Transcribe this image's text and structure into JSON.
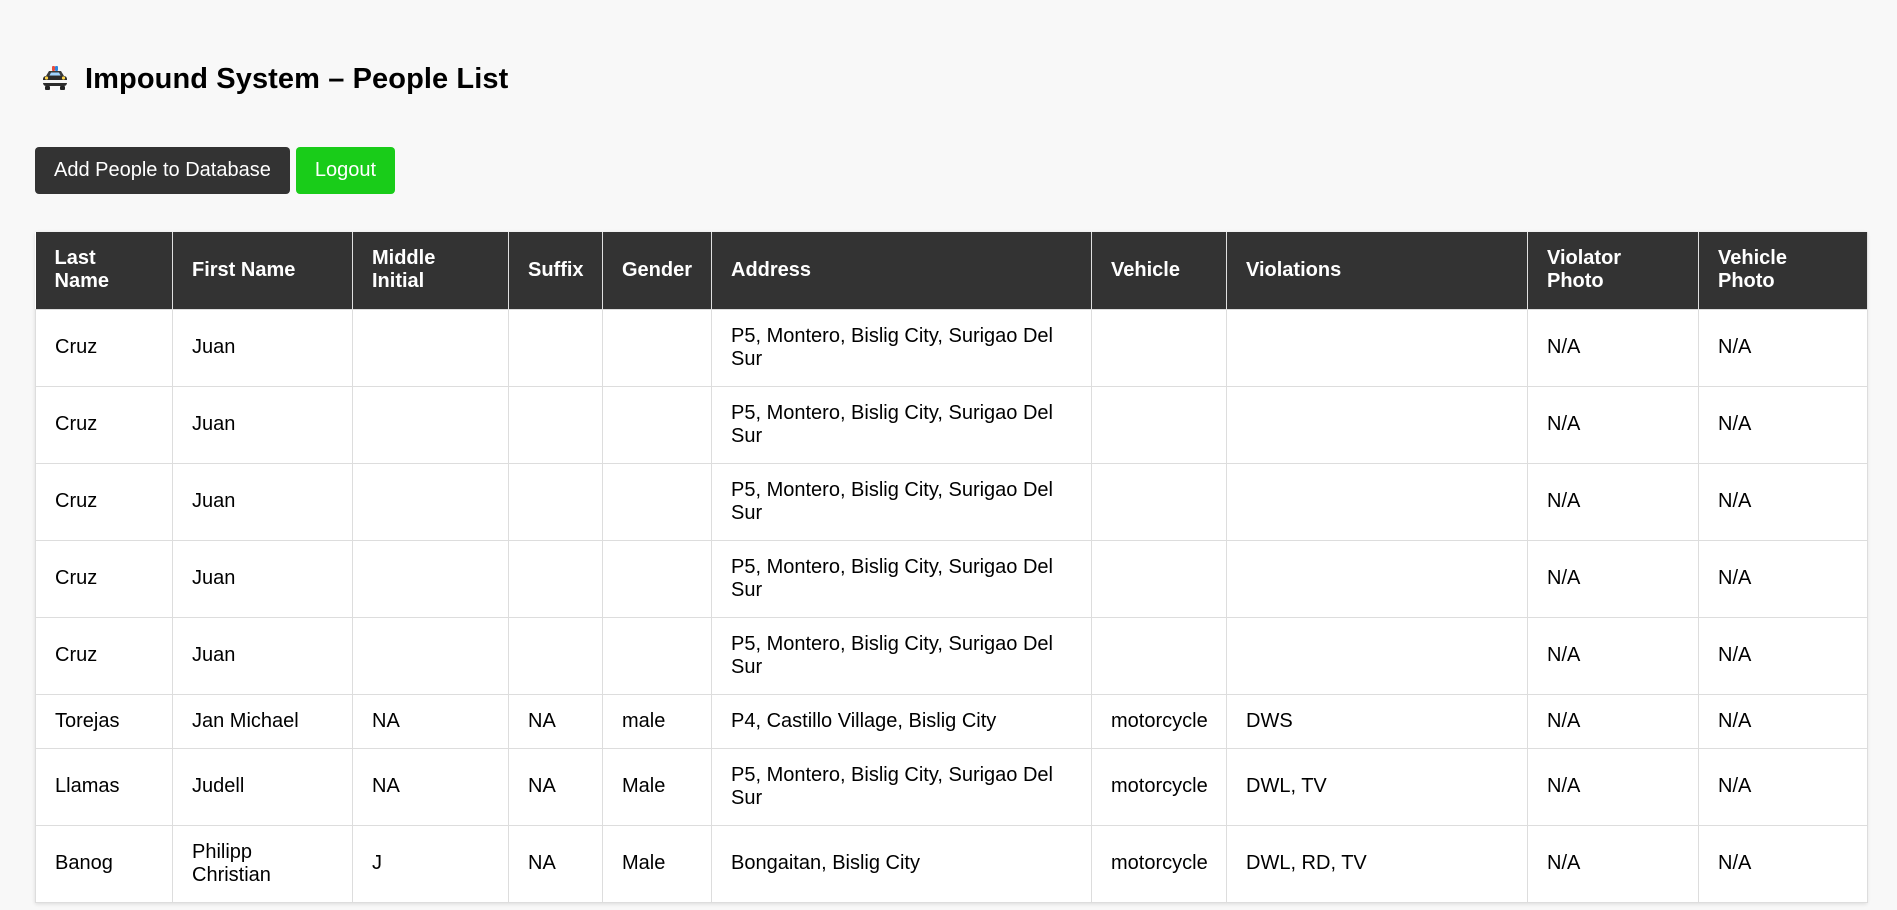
{
  "header": {
    "icon": "police-car-icon",
    "title": "Impound System – People List"
  },
  "actions": {
    "add_label": "Add People to Database",
    "logout_label": "Logout",
    "add_color": "#333333",
    "logout_color": "#19cc19"
  },
  "table": {
    "columns": [
      "Last Name",
      "First Name",
      "Middle Initial",
      "Suffix",
      "Gender",
      "Address",
      "Vehicle",
      "Violations",
      "Violator Photo",
      "Vehicle Photo"
    ],
    "rows": [
      [
        "Cruz",
        "Juan",
        "",
        "",
        "",
        "P5, Montero, Bislig City, Surigao Del Sur",
        "",
        "",
        "N/A",
        "N/A"
      ],
      [
        "Cruz",
        "Juan",
        "",
        "",
        "",
        "P5, Montero, Bislig City, Surigao Del Sur",
        "",
        "",
        "N/A",
        "N/A"
      ],
      [
        "Cruz",
        "Juan",
        "",
        "",
        "",
        "P5, Montero, Bislig City, Surigao Del Sur",
        "",
        "",
        "N/A",
        "N/A"
      ],
      [
        "Cruz",
        "Juan",
        "",
        "",
        "",
        "P5, Montero, Bislig City, Surigao Del Sur",
        "",
        "",
        "N/A",
        "N/A"
      ],
      [
        "Cruz",
        "Juan",
        "",
        "",
        "",
        "P5, Montero, Bislig City, Surigao Del Sur",
        "",
        "",
        "N/A",
        "N/A"
      ],
      [
        "Torejas",
        "Jan Michael",
        "NA",
        "NA",
        "male",
        "P4, Castillo Village, Bislig City",
        "motorcycle",
        "DWS",
        "N/A",
        "N/A"
      ],
      [
        "Llamas",
        "Judell",
        "NA",
        "NA",
        "Male",
        "P5, Montero, Bislig City, Surigao Del Sur",
        "motorcycle",
        "DWL, TV",
        "N/A",
        "N/A"
      ],
      [
        "Banog",
        "Philipp Christian",
        "J",
        "NA",
        "Male",
        "Bongaitan, Bislig City",
        "motorcycle",
        "DWL, RD, TV",
        "N/A",
        "N/A"
      ]
    ]
  }
}
